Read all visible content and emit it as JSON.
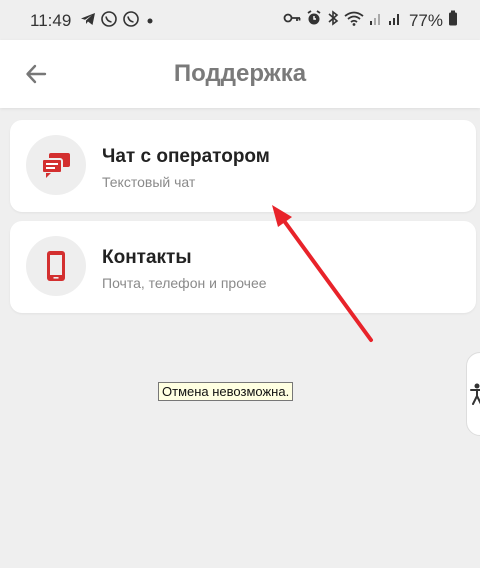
{
  "statusbar": {
    "time": "11:49",
    "battery_percent": "77%",
    "left_icons": [
      "telegram-icon",
      "viber-icon",
      "viber-icon",
      "dot-icon"
    ],
    "right_icons": [
      "key-icon",
      "alarm-icon",
      "bluetooth-icon",
      "wifi-icon",
      "signal-icon",
      "signal-icon",
      "battery-icon"
    ]
  },
  "appbar": {
    "title": "Поддержка",
    "back_icon": "back-arrow-icon"
  },
  "cards": [
    {
      "title": "Чат с оператором",
      "subtitle": "Текстовый чат",
      "icon": "chat-bubbles-icon"
    },
    {
      "title": "Контакты",
      "subtitle": "Почта, телефон и прочее",
      "icon": "phone-icon"
    }
  ],
  "tooltip": {
    "text": "Отмена невозможна."
  },
  "side_handle": {
    "icon": "accessibility-icon"
  },
  "colors": {
    "accent": "#d32f2f",
    "annotation_arrow": "#e8232a",
    "background": "#efefef",
    "title_gray": "#7a7a7a"
  }
}
